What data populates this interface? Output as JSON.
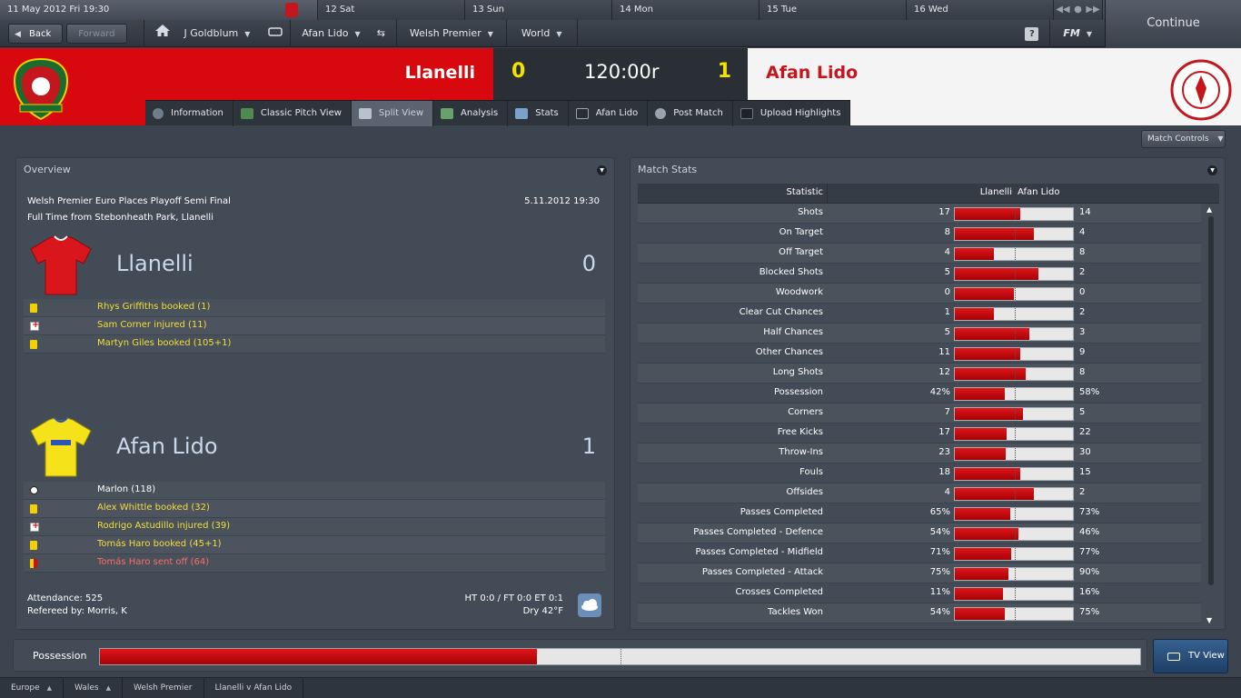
{
  "calendar": {
    "today": "11 May 2012  Fri 19:30",
    "days": [
      "12  Sat",
      "13  Sun",
      "14  Mon",
      "15  Tue",
      "16  Wed"
    ]
  },
  "nav": {
    "back": "Back",
    "forward": "Forward",
    "manager": "J Goldblum",
    "club": "Afan Lido",
    "league": "Welsh Premier",
    "world": "World",
    "help": "?",
    "fm_menu": "FM",
    "continue": "Continue"
  },
  "score": {
    "home_team": "Llanelli",
    "home_score": "0",
    "clock": "120:00r",
    "away_score": "1",
    "away_team": "Afan Lido"
  },
  "tabs": [
    {
      "label": "Information",
      "icon": "info-icon"
    },
    {
      "label": "Classic Pitch View",
      "icon": "pitch-icon"
    },
    {
      "label": "Split View",
      "icon": "split-view-icon",
      "active": true
    },
    {
      "label": "Analysis",
      "icon": "analysis-icon"
    },
    {
      "label": "Stats",
      "icon": "stats-icon"
    },
    {
      "label": "Afan Lido",
      "icon": "team-icon"
    },
    {
      "label": "Post Match",
      "icon": "post-match-icon"
    },
    {
      "label": "Upload Highlights",
      "icon": "camera-icon"
    }
  ],
  "match_controls": "Match Controls",
  "overview": {
    "title": "Overview",
    "competition": "Welsh Premier Euro Places Playoff Semi Final",
    "date": "5.11.2012 19:30",
    "venue": "Full Time from Stebonheath Park, Llanelli",
    "home": {
      "name": "Llanelli",
      "score": "0",
      "kit_color": "#d8161c",
      "events": [
        {
          "type": "yellow",
          "text": "Rhys Griffiths booked (1)"
        },
        {
          "type": "injury",
          "text": "Sam Corner injured (11)"
        },
        {
          "type": "yellow",
          "text": "Martyn Giles booked (105+1)"
        }
      ]
    },
    "away": {
      "name": "Afan Lido",
      "score": "1",
      "kit_color": "#f5e21a",
      "events": [
        {
          "type": "goal",
          "text": "Marlon (118)"
        },
        {
          "type": "yellow",
          "text": "Alex Whittle booked (32)"
        },
        {
          "type": "injury",
          "text": "Rodrigo Astudillo injured (39)"
        },
        {
          "type": "yellow",
          "text": "Tomás Haro booked (45+1)"
        },
        {
          "type": "red",
          "text": "Tomás Haro sent off (64)"
        }
      ]
    },
    "attendance": "Attendance: 525",
    "referee": "Refereed by: Morris, K",
    "halftime": "HT 0:0 / FT 0:0 ET 0:1",
    "weather": "Dry 42°F",
    "weather_icon": "cloud-icon"
  },
  "match_stats": {
    "title": "Match Stats",
    "header_statistic": "Statistic",
    "header_home": "Llanelli",
    "header_away": "Afan Lido",
    "rows": [
      {
        "name": "Shots",
        "home": "17",
        "away": "14",
        "share": 0.55
      },
      {
        "name": "On Target",
        "home": "8",
        "away": "4",
        "share": 0.67
      },
      {
        "name": "Off Target",
        "home": "4",
        "away": "8",
        "share": 0.33
      },
      {
        "name": "Blocked Shots",
        "home": "5",
        "away": "2",
        "share": 0.71
      },
      {
        "name": "Woodwork",
        "home": "0",
        "away": "0",
        "share": 0.5
      },
      {
        "name": "Clear Cut Chances",
        "home": "1",
        "away": "2",
        "share": 0.33
      },
      {
        "name": "Half Chances",
        "home": "5",
        "away": "3",
        "share": 0.63
      },
      {
        "name": "Other Chances",
        "home": "11",
        "away": "9",
        "share": 0.55
      },
      {
        "name": "Long Shots",
        "home": "12",
        "away": "8",
        "share": 0.6
      },
      {
        "name": "Possession",
        "home": "42%",
        "away": "58%",
        "share": 0.42
      },
      {
        "name": "Corners",
        "home": "7",
        "away": "5",
        "share": 0.58
      },
      {
        "name": "Free Kicks",
        "home": "17",
        "away": "22",
        "share": 0.44
      },
      {
        "name": "Throw-Ins",
        "home": "23",
        "away": "30",
        "share": 0.43
      },
      {
        "name": "Fouls",
        "home": "18",
        "away": "15",
        "share": 0.55
      },
      {
        "name": "Offsides",
        "home": "4",
        "away": "2",
        "share": 0.67
      },
      {
        "name": "Passes Completed",
        "home": "65%",
        "away": "73%",
        "share": 0.47
      },
      {
        "name": "Passes Completed - Defence",
        "home": "54%",
        "away": "46%",
        "share": 0.54
      },
      {
        "name": "Passes Completed - Midfield",
        "home": "71%",
        "away": "77%",
        "share": 0.48
      },
      {
        "name": "Passes Completed - Attack",
        "home": "75%",
        "away": "90%",
        "share": 0.45
      },
      {
        "name": "Crosses Completed",
        "home": "11%",
        "away": "16%",
        "share": 0.41
      },
      {
        "name": "Tackles Won",
        "home": "54%",
        "away": "75%",
        "share": 0.42
      }
    ]
  },
  "possession": {
    "label": "Possession",
    "home_share": 0.42
  },
  "tv_view": "TV View",
  "breadcrumbs": [
    "Europe",
    "Wales",
    "Welsh Premier",
    "Llanelli v Afan Lido"
  ],
  "colors": {
    "home_red": "#d8090e",
    "score_yellow": "#f3e200",
    "away_red_text": "#c4161c"
  }
}
